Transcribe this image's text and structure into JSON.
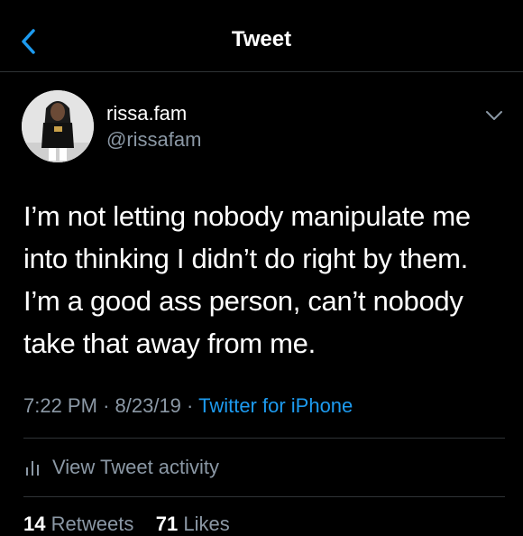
{
  "header": {
    "title": "Tweet",
    "back_icon": "chevron-left-icon"
  },
  "author": {
    "display_name": "rissa.fam",
    "handle": "@rissafam",
    "avatar_icon": "profile-photo",
    "menu_icon": "chevron-down-icon"
  },
  "tweet": {
    "text_lines": [
      "I’m not letting nobody manipulate me",
      "into thinking I didn’t do right by them.",
      "I’m a good ass person, can’t nobody",
      "take that away from me."
    ],
    "time": "7:22 PM",
    "date": "8/23/19",
    "separator": "·",
    "source": "Twitter for iPhone"
  },
  "activity": {
    "label": "View Tweet activity",
    "icon": "bar-chart-icon"
  },
  "stats": {
    "retweets_count": "14",
    "retweets_label": "Retweets",
    "likes_count": "71",
    "likes_label": "Likes"
  },
  "colors": {
    "background": "#000000",
    "text": "#ffffff",
    "secondary": "#8b98a5",
    "accent": "#1d9bf0",
    "divider": "#2f3336"
  }
}
